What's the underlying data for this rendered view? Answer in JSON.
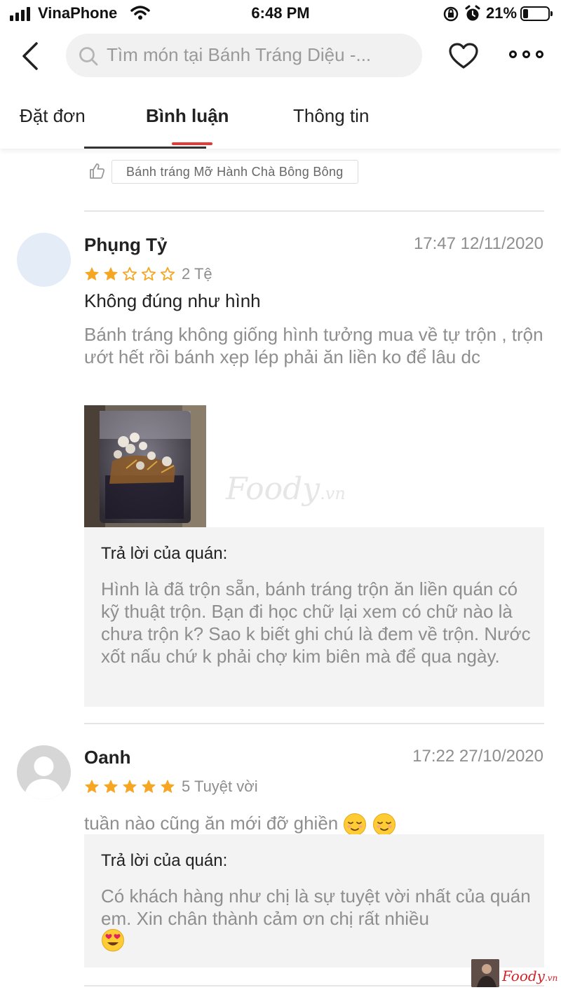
{
  "status_bar": {
    "carrier": "VinaPhone",
    "time": "6:48 PM",
    "battery_percent": "21%",
    "battery_level": 0.21
  },
  "header": {
    "search_placeholder": "Tìm món tại Bánh Tráng Diệu -..."
  },
  "tabs": [
    {
      "label": "Đặt đơn",
      "active": false
    },
    {
      "label": "Bình luận",
      "active": true
    },
    {
      "label": "Thông tin",
      "active": false
    }
  ],
  "previous_review": {
    "tag": "Bánh tráng Mỡ Hành Chà Bông Bông"
  },
  "reviews": [
    {
      "name": "Phụng Tỷ",
      "date": "17:47 12/11/2020",
      "stars": 2,
      "rating_label": "2 Tệ",
      "title": "Không đúng như hình",
      "body": "Bánh tráng không giống hình tưởng mua về tự trộn , trộn ướt hết rồi bánh xẹp lép phải ăn liền ko để lâu dc",
      "reply_title": "Trả lời của quán:",
      "reply_body": "Hình là đã trộn sẵn, bánh tráng trộn ăn liền quán có kỹ thuật trộn. Bạn đi học chữ lại xem có chữ nào là chưa trộn k? Sao k biết ghi chú là đem về trộn. Nước xốt nấu chứ k phải chợ kim biên mà để qua ngày."
    },
    {
      "name": "Oanh",
      "date": "17:22 27/10/2020",
      "stars": 5,
      "rating_label": "5 Tuyệt vời",
      "body": "tuần nào cũng ăn mới đỡ ghiền",
      "reply_title": "Trả lời của quán:",
      "reply_body": "Có khách hàng như chị là sự tuyệt vời nhất của quán em. Xin chân thành cảm ơn chị rất nhiều"
    }
  ],
  "watermark": {
    "text": "Foody",
    "suffix": ".vn"
  },
  "corner_logo": {
    "text": "Foody",
    "suffix": ".vn"
  },
  "colors": {
    "accent": "#e53935",
    "star": "#f6a623",
    "muted_text": "#8e8e8e",
    "reply_bg": "#f3f3f3"
  }
}
